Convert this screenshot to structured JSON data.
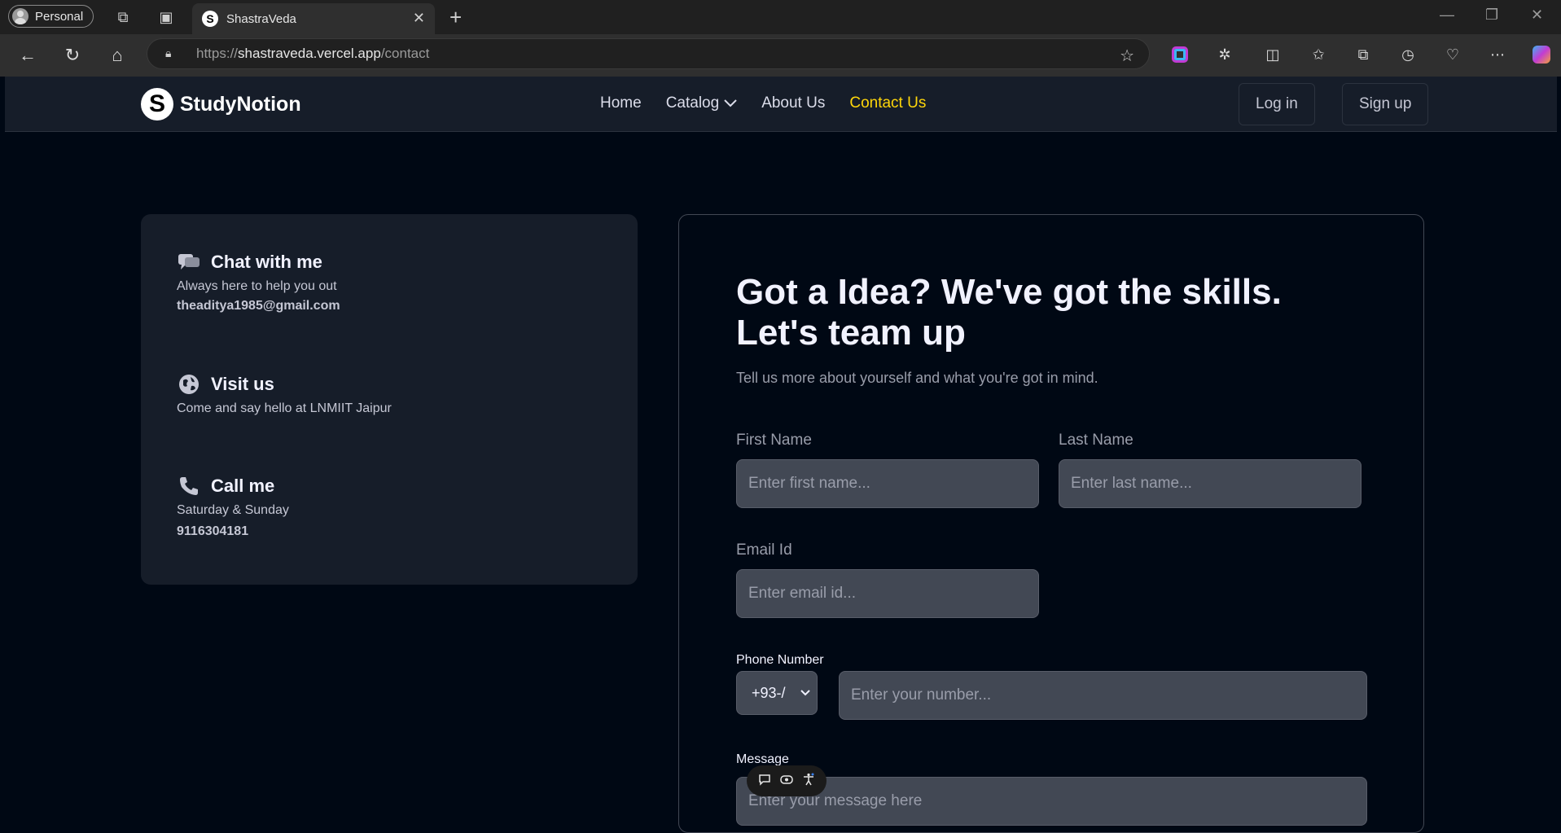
{
  "browser": {
    "profile_label": "Personal",
    "tab_title": "ShastraVeda",
    "tab_favicon_letter": "S",
    "url_prefix": "https://",
    "url_host": "shastraveda.vercel.app",
    "url_path": "/contact"
  },
  "navbar": {
    "logo_letter": "S",
    "logo_text": "StudyNotion",
    "menu": {
      "home": "Home",
      "catalog": "Catalog",
      "about": "About Us",
      "contact": "Contact Us"
    },
    "login": "Log in",
    "signup": "Sign up"
  },
  "info": {
    "chat_title": "Chat with me",
    "chat_line": "Always here to help you out",
    "chat_email": "theaditya1985@gmail.com",
    "visit_title": "Visit us",
    "visit_line": "Come and say hello at LNMIIT Jaipur",
    "call_title": "Call me",
    "call_line": "Saturday & Sunday",
    "call_number": "9116304181"
  },
  "form": {
    "title_line1": "Got a Idea? We've got the skills.",
    "title_line2": "Let's team up",
    "subtitle": "Tell us more about yourself and what you're got in mind.",
    "first_name_label": "First Name",
    "first_name_placeholder": "Enter first name...",
    "last_name_label": "Last Name",
    "last_name_placeholder": "Enter last name...",
    "email_label": "Email Id",
    "email_placeholder": "Enter email id...",
    "phone_label": "Phone Number",
    "country_code": "+93-/",
    "phone_placeholder": "Enter your number...",
    "message_label": "Message",
    "message_placeholder": "Enter your message here"
  },
  "colors": {
    "accent_yellow": "#ffd60a",
    "page_bg": "#000814",
    "card_bg": "#161d29",
    "input_bg": "#424854"
  }
}
